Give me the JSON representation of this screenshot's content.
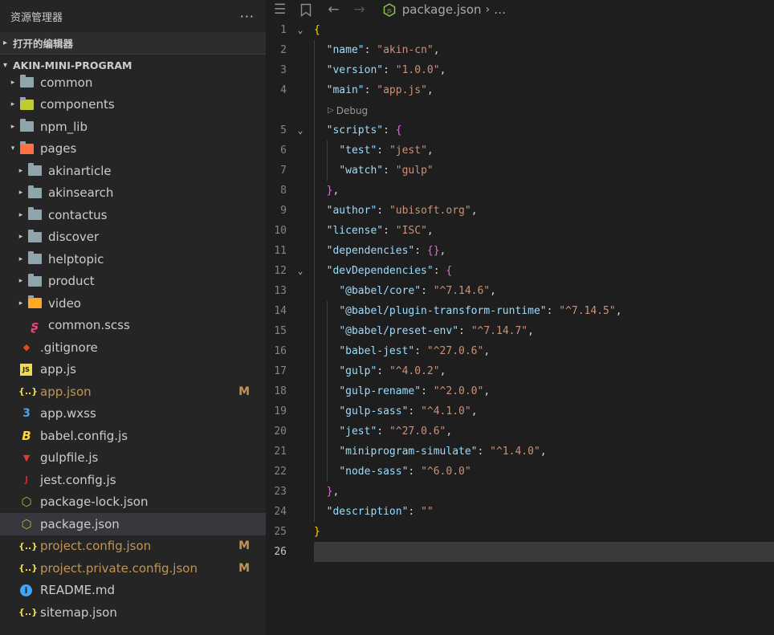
{
  "sidebar": {
    "title": "资源管理器",
    "more": "···",
    "open_editors": "打开的编辑器",
    "project": "AKIN-MINI-PROGRAM",
    "items": [
      {
        "label": "common",
        "depth": 0,
        "twisty": "▸",
        "icon": "folder-icon",
        "badge": ""
      },
      {
        "label": "components",
        "depth": 0,
        "twisty": "▸",
        "icon": "components-folder-icon",
        "badge": ""
      },
      {
        "label": "npm_lib",
        "depth": 0,
        "twisty": "▸",
        "icon": "folder-icon",
        "badge": ""
      },
      {
        "label": "pages",
        "depth": 0,
        "twisty": "▾",
        "icon": "pages-folder-icon",
        "badge": ""
      },
      {
        "label": "akinarticle",
        "depth": 1,
        "twisty": "▸",
        "icon": "folder-icon",
        "badge": ""
      },
      {
        "label": "akinsearch",
        "depth": 1,
        "twisty": "▸",
        "icon": "folder-icon",
        "badge": ""
      },
      {
        "label": "contactus",
        "depth": 1,
        "twisty": "▸",
        "icon": "folder-icon",
        "badge": ""
      },
      {
        "label": "discover",
        "depth": 1,
        "twisty": "▸",
        "icon": "folder-icon",
        "badge": ""
      },
      {
        "label": "helptopic",
        "depth": 1,
        "twisty": "▸",
        "icon": "folder-icon",
        "badge": ""
      },
      {
        "label": "product",
        "depth": 1,
        "twisty": "▸",
        "icon": "folder-icon",
        "badge": ""
      },
      {
        "label": "video",
        "depth": 1,
        "twisty": "▸",
        "icon": "video-folder-icon",
        "badge": ""
      },
      {
        "label": "common.scss",
        "depth": 1,
        "twisty": "",
        "icon": "sass-icon",
        "badge": ""
      },
      {
        "label": ".gitignore",
        "depth": 0,
        "twisty": "",
        "icon": "git-icon",
        "badge": ""
      },
      {
        "label": "app.js",
        "depth": 0,
        "twisty": "",
        "icon": "js-icon",
        "badge": ""
      },
      {
        "label": "app.json",
        "depth": 0,
        "twisty": "",
        "icon": "json-icon",
        "badge": "M",
        "modified": true
      },
      {
        "label": "app.wxss",
        "depth": 0,
        "twisty": "",
        "icon": "css-icon",
        "badge": ""
      },
      {
        "label": "babel.config.js",
        "depth": 0,
        "twisty": "",
        "icon": "babel-icon",
        "badge": ""
      },
      {
        "label": "gulpfile.js",
        "depth": 0,
        "twisty": "",
        "icon": "gulp-icon",
        "badge": ""
      },
      {
        "label": "jest.config.js",
        "depth": 0,
        "twisty": "",
        "icon": "jest-icon",
        "badge": ""
      },
      {
        "label": "package-lock.json",
        "depth": 0,
        "twisty": "",
        "icon": "nodejs-icon",
        "badge": ""
      },
      {
        "label": "package.json",
        "depth": 0,
        "twisty": "",
        "icon": "nodejs-icon",
        "badge": "",
        "selected": true
      },
      {
        "label": "project.config.json",
        "depth": 0,
        "twisty": "",
        "icon": "json-icon",
        "badge": "M",
        "modified": true
      },
      {
        "label": "project.private.config.json",
        "depth": 0,
        "twisty": "",
        "icon": "json-icon",
        "badge": "M",
        "modified": true
      },
      {
        "label": "README.md",
        "depth": 0,
        "twisty": "",
        "icon": "info-icon",
        "badge": ""
      },
      {
        "label": "sitemap.json",
        "depth": 0,
        "twisty": "",
        "icon": "json-icon",
        "badge": ""
      }
    ]
  },
  "editor": {
    "breadcrumb_file": "package.json",
    "breadcrumb_more": "…",
    "codelens": "Debug",
    "current_line": "26",
    "lines": [
      {
        "n": "1",
        "fold": "⌄",
        "tokens": [
          [
            "{",
            "b1"
          ]
        ]
      },
      {
        "n": "2",
        "tokens": [
          [
            "  ",
            ""
          ],
          [
            "\"name\"",
            "k"
          ],
          [
            ": ",
            "p"
          ],
          [
            "\"akin-cn\"",
            "s"
          ],
          [
            ",",
            "p"
          ]
        ]
      },
      {
        "n": "3",
        "tokens": [
          [
            "  ",
            ""
          ],
          [
            "\"version\"",
            "k"
          ],
          [
            ": ",
            "p"
          ],
          [
            "\"1.0.0\"",
            "s"
          ],
          [
            ",",
            "p"
          ]
        ]
      },
      {
        "n": "4",
        "tokens": [
          [
            "  ",
            ""
          ],
          [
            "\"main\"",
            "k"
          ],
          [
            ": ",
            "p"
          ],
          [
            "\"app.js\"",
            "s"
          ],
          [
            ",",
            "p"
          ]
        ],
        "lens_after": true
      },
      {
        "n": "5",
        "fold": "⌄",
        "tokens": [
          [
            "  ",
            ""
          ],
          [
            "\"scripts\"",
            "k"
          ],
          [
            ": ",
            "p"
          ],
          [
            "{",
            "b2"
          ]
        ]
      },
      {
        "n": "6",
        "tokens": [
          [
            "    ",
            ""
          ],
          [
            "\"test\"",
            "k"
          ],
          [
            ": ",
            "p"
          ],
          [
            "\"jest\"",
            "s"
          ],
          [
            ",",
            "p"
          ]
        ]
      },
      {
        "n": "7",
        "tokens": [
          [
            "    ",
            ""
          ],
          [
            "\"watch\"",
            "k"
          ],
          [
            ": ",
            "p"
          ],
          [
            "\"gulp\"",
            "s"
          ]
        ]
      },
      {
        "n": "8",
        "tokens": [
          [
            "  ",
            ""
          ],
          [
            "}",
            "b2"
          ],
          [
            ",",
            "p"
          ]
        ]
      },
      {
        "n": "9",
        "tokens": [
          [
            "  ",
            ""
          ],
          [
            "\"author\"",
            "k"
          ],
          [
            ": ",
            "p"
          ],
          [
            "\"ubisoft.org\"",
            "s"
          ],
          [
            ",",
            "p"
          ]
        ]
      },
      {
        "n": "10",
        "tokens": [
          [
            "  ",
            ""
          ],
          [
            "\"license\"",
            "k"
          ],
          [
            ": ",
            "p"
          ],
          [
            "\"ISC\"",
            "s"
          ],
          [
            ",",
            "p"
          ]
        ]
      },
      {
        "n": "11",
        "tokens": [
          [
            "  ",
            ""
          ],
          [
            "\"dependencies\"",
            "k"
          ],
          [
            ": ",
            "p"
          ],
          [
            "{}",
            "b2"
          ],
          [
            ",",
            "p"
          ]
        ]
      },
      {
        "n": "12",
        "fold": "⌄",
        "tokens": [
          [
            "  ",
            ""
          ],
          [
            "\"devDependencies\"",
            "k"
          ],
          [
            ": ",
            "p"
          ],
          [
            "{",
            "b2"
          ]
        ]
      },
      {
        "n": "13",
        "tokens": [
          [
            "    ",
            ""
          ],
          [
            "\"@babel/core\"",
            "k"
          ],
          [
            ": ",
            "p"
          ],
          [
            "\"^7.14.6\"",
            "s"
          ],
          [
            ",",
            "p"
          ]
        ]
      },
      {
        "n": "14",
        "tokens": [
          [
            "    ",
            ""
          ],
          [
            "\"@babel/plugin-transform-runtime\"",
            "k"
          ],
          [
            ": ",
            "p"
          ],
          [
            "\"^7.14.5\"",
            "s"
          ],
          [
            ",",
            "p"
          ]
        ]
      },
      {
        "n": "15",
        "tokens": [
          [
            "    ",
            ""
          ],
          [
            "\"@babel/preset-env\"",
            "k"
          ],
          [
            ": ",
            "p"
          ],
          [
            "\"^7.14.7\"",
            "s"
          ],
          [
            ",",
            "p"
          ]
        ]
      },
      {
        "n": "16",
        "tokens": [
          [
            "    ",
            ""
          ],
          [
            "\"babel-jest\"",
            "k"
          ],
          [
            ": ",
            "p"
          ],
          [
            "\"^27.0.6\"",
            "s"
          ],
          [
            ",",
            "p"
          ]
        ]
      },
      {
        "n": "17",
        "tokens": [
          [
            "    ",
            ""
          ],
          [
            "\"gulp\"",
            "k"
          ],
          [
            ": ",
            "p"
          ],
          [
            "\"^4.0.2\"",
            "s"
          ],
          [
            ",",
            "p"
          ]
        ]
      },
      {
        "n": "18",
        "tokens": [
          [
            "    ",
            ""
          ],
          [
            "\"gulp-rename\"",
            "k"
          ],
          [
            ": ",
            "p"
          ],
          [
            "\"^2.0.0\"",
            "s"
          ],
          [
            ",",
            "p"
          ]
        ]
      },
      {
        "n": "19",
        "tokens": [
          [
            "    ",
            ""
          ],
          [
            "\"gulp-sass\"",
            "k"
          ],
          [
            ": ",
            "p"
          ],
          [
            "\"^4.1.0\"",
            "s"
          ],
          [
            ",",
            "p"
          ]
        ]
      },
      {
        "n": "20",
        "tokens": [
          [
            "    ",
            ""
          ],
          [
            "\"jest\"",
            "k"
          ],
          [
            ": ",
            "p"
          ],
          [
            "\"^27.0.6\"",
            "s"
          ],
          [
            ",",
            "p"
          ]
        ]
      },
      {
        "n": "21",
        "tokens": [
          [
            "    ",
            ""
          ],
          [
            "\"miniprogram-simulate\"",
            "k"
          ],
          [
            ": ",
            "p"
          ],
          [
            "\"^1.4.0\"",
            "s"
          ],
          [
            ",",
            "p"
          ]
        ]
      },
      {
        "n": "22",
        "tokens": [
          [
            "    ",
            ""
          ],
          [
            "\"node-sass\"",
            "k"
          ],
          [
            ": ",
            "p"
          ],
          [
            "\"^6.0.0\"",
            "s"
          ]
        ]
      },
      {
        "n": "23",
        "tokens": [
          [
            "  ",
            ""
          ],
          [
            "}",
            "b2"
          ],
          [
            ",",
            "p"
          ]
        ]
      },
      {
        "n": "24",
        "tokens": [
          [
            "  ",
            ""
          ],
          [
            "\"description\"",
            "k"
          ],
          [
            ": ",
            "p"
          ],
          [
            "\"\"",
            "s"
          ]
        ]
      },
      {
        "n": "25",
        "tokens": [
          [
            "}",
            "b1"
          ]
        ]
      },
      {
        "n": "26",
        "tokens": [],
        "current": true
      }
    ]
  },
  "colors": {
    "modified": "#c09553",
    "folder": "#90a4ae",
    "pages_folder": "#ff7043",
    "components_folder": "#c0ca33",
    "video_folder": "#ffa726",
    "js": "#f0db4f",
    "json": "#f0db4f",
    "css": "#42a5f5",
    "git": "#e64a19",
    "node": "#8bc34a",
    "info": "#42a5f5",
    "sass": "#ec407a",
    "babel": "#fdd835",
    "gulp": "#e53935",
    "jest": "#c62828"
  }
}
